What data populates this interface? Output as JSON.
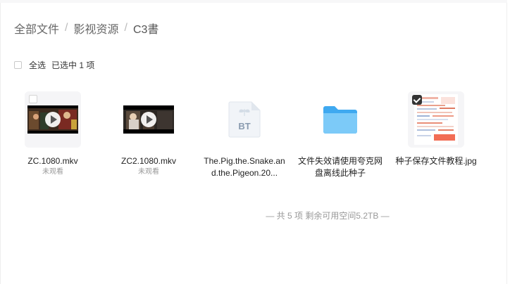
{
  "breadcrumb": {
    "root": "全部文件",
    "parent": "影视资源",
    "current": "C3書",
    "separator": "/"
  },
  "selection": {
    "select_all_label": "全选",
    "selected_text": "已选中  1 项"
  },
  "files": [
    {
      "name": "ZC.1080.mkv",
      "status": "未观看",
      "type": "video",
      "icon": "video-thumbnail"
    },
    {
      "name": "ZC2.1080.mkv",
      "status": "未观看",
      "type": "video",
      "icon": "video-thumbnail"
    },
    {
      "name": "The.Pig.the.Snake.and.the.Pigeon.20...",
      "type": "torrent",
      "icon": "bt-file-icon",
      "icon_text": "BT"
    },
    {
      "name": "文件失效请使用夸克网盘离线此种子",
      "type": "folder",
      "icon": "folder-icon"
    },
    {
      "name": "种子保存文件教程.jpg",
      "type": "image",
      "icon": "image-thumbnail",
      "selected": true
    }
  ],
  "footer": {
    "summary": "— 共 5 项 剩余可用空间5.2TB —"
  },
  "colors": {
    "folder": "#5bb8f5",
    "bt_text": "#8a9bb0",
    "checked": "#333333",
    "muted_text": "#999999"
  }
}
